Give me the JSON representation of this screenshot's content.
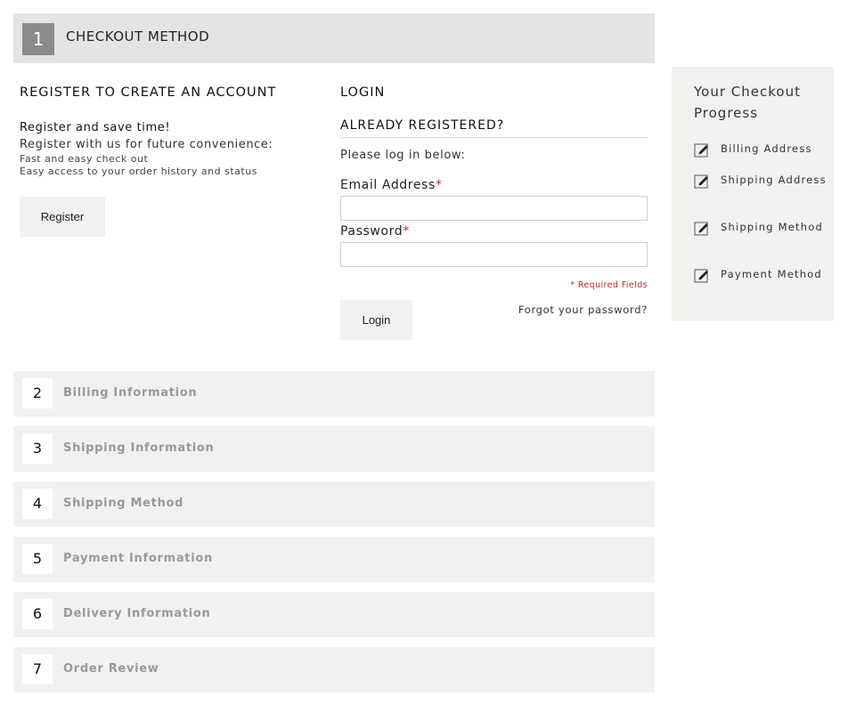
{
  "step1": {
    "number": "1",
    "title": "CHECKOUT METHOD"
  },
  "register": {
    "heading": "REGISTER TO CREATE AN ACCOUNT",
    "line1": "Register and save time!",
    "line2": "Register with us for future convenience:",
    "line3": "Fast and easy check out",
    "line4": "Easy access to your order history and status",
    "button_label": "Register"
  },
  "login": {
    "heading": "LOGIN",
    "subheading": "ALREADY REGISTERED?",
    "intro": "Please log in below:",
    "email_label": "Email Address",
    "password_label": "Password",
    "required_marker": "*",
    "email_value": "",
    "password_value": "",
    "required_fields_note": "* Required Fields",
    "forgot_link": "Forgot your password?",
    "button_label": "Login"
  },
  "steps": [
    {
      "number": "2",
      "label": "Billing Information"
    },
    {
      "number": "3",
      "label": "Shipping Information"
    },
    {
      "number": "4",
      "label": "Shipping Method"
    },
    {
      "number": "5",
      "label": "Payment Information"
    },
    {
      "number": "6",
      "label": "Delivery Information"
    },
    {
      "number": "7",
      "label": "Order Review"
    }
  ],
  "progress": {
    "title": "Your Checkout Progress",
    "items": [
      {
        "label": "Billing Address",
        "icon": "edit-icon"
      },
      {
        "label": "Shipping Address",
        "icon": "edit-icon"
      },
      {
        "label": "Shipping Method",
        "icon": "edit-icon"
      },
      {
        "label": "Payment Method",
        "icon": "edit-icon"
      }
    ]
  },
  "colors": {
    "header_bg": "#e4e4e4",
    "panel_bg": "#f1f1ef",
    "step_badge": "#8a8a8a",
    "required": "#c0282d",
    "step_label": "#999999"
  }
}
